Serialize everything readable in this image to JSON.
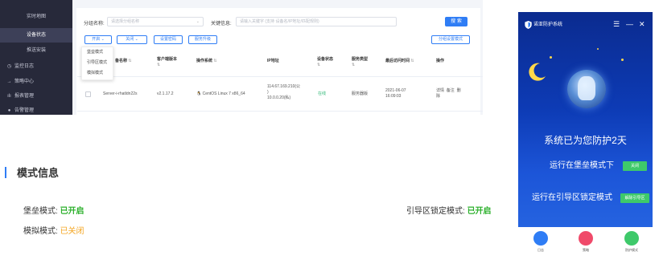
{
  "sidebar": {
    "items": [
      {
        "label": "实时地图",
        "icon": ""
      },
      {
        "label": "设备状态",
        "icon": ""
      },
      {
        "label": "推送安装",
        "icon": ""
      },
      {
        "label": "监控日志",
        "icon": "clock-icon"
      },
      {
        "label": "策略中心",
        "icon": "arrow-right-icon"
      },
      {
        "label": "报表管理",
        "icon": "bar-chart-icon"
      },
      {
        "label": "告警管理",
        "icon": "alert-icon"
      }
    ]
  },
  "filters": {
    "group_label": "分组名称:",
    "group_placeholder": "请选择分组名称",
    "keyword_label": "关键信息:",
    "keyword_placeholder": "请输入关键字 (支持 设备名/IP地址/匹配规则)",
    "search_button": "搜 索"
  },
  "toolbar": {
    "open_label": "开启",
    "close_label": "关闭",
    "set_password_label": "设置密码",
    "service_upgrade_label": "服务升级",
    "group_mode_label": "分组设置模式"
  },
  "dropdown": {
    "items": [
      "堡垒模式",
      "引导区模式",
      "模拟模式"
    ]
  },
  "table": {
    "columns": [
      "备名称",
      "客户端版本",
      "操作系统",
      "IP地址",
      "设备状态",
      "服务类型",
      "最后访问时间",
      "操作"
    ],
    "row": {
      "name": "Server-i-rhatldn22s",
      "version": "v2.1.17.2",
      "os": "CentOS Linux 7 x86_64",
      "ip_line1": "114.67.169.210(公",
      "ip_line2": ")",
      "ip_line3": "10.0.0.20(私)",
      "status": "在线",
      "service": "服务器版",
      "date": "2021-06-07",
      "time": "16:09:03",
      "action_detail": "详情",
      "action_note": "备注",
      "action_delete": "删",
      "action_delete2": "除"
    }
  },
  "info": {
    "title": "模式信息",
    "bastion_label": "堡垒模式:",
    "bastion_value": "已开启",
    "simulate_label": "模拟模式:",
    "simulate_value": "已关闭",
    "boot_label": "引导区锁定模式:",
    "boot_value": "已开启"
  },
  "phone": {
    "title": "诺亚防护系统",
    "headline": "系统已为您防护2天",
    "row1_text": "运行在堡垒模式下",
    "row1_button": "关闭",
    "row2_text": "运行在引导区锁定模式",
    "row2_button": "解除引导区",
    "bottom_labels": [
      "日志",
      "策略",
      "防护模式"
    ],
    "colors": {
      "accent": "#3ec96a",
      "bg": "#0d3bb5"
    }
  },
  "colors": {
    "primary": "#2f7df5",
    "success": "#2bb02b",
    "warning": "#f4a623",
    "sidebar": "#27293a"
  }
}
